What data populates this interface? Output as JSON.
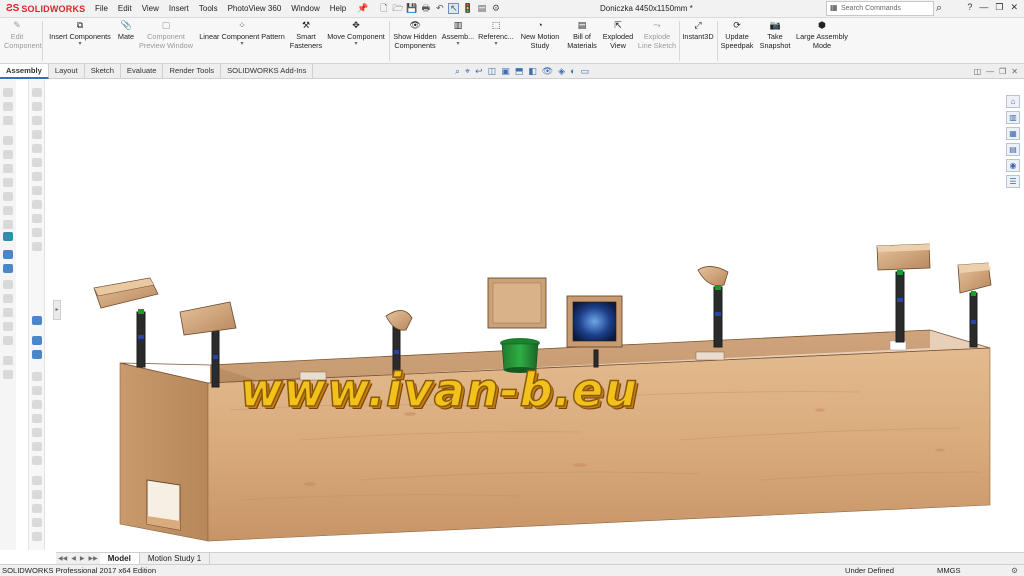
{
  "app": {
    "brand": "SOLIDWORKS",
    "document_title": "Doniczka 4450x1150mm *"
  },
  "menu": [
    "File",
    "Edit",
    "View",
    "Insert",
    "Tools",
    "PhotoView 360",
    "Window",
    "Help"
  ],
  "search": {
    "placeholder": "Search Commands"
  },
  "ribbon": {
    "edit_component": [
      "Edit",
      "Component"
    ],
    "insert_components": "Insert Components",
    "mate": "Mate",
    "component_preview": [
      "Component",
      "Preview Window"
    ],
    "linear_pattern": "Linear Component Pattern",
    "smart_fasteners": [
      "Smart",
      "Fasteners"
    ],
    "move_component": "Move Component",
    "show_hidden": [
      "Show Hidden",
      "Components"
    ],
    "assembly_features": "Assemb...",
    "reference_geometry": "Referenc...",
    "new_motion_study": [
      "New Motion",
      "Study"
    ],
    "bill_of_materials": [
      "Bill of",
      "Materials"
    ],
    "exploded_view": [
      "Exploded",
      "View"
    ],
    "explode_line_sketch": [
      "Explode",
      "Line Sketch"
    ],
    "instant3d": "Instant3D",
    "update_speedpak": [
      "Update",
      "Speedpak"
    ],
    "take_snapshot": [
      "Take",
      "Snapshot"
    ],
    "large_assembly_mode": [
      "Large Assembly",
      "Mode"
    ]
  },
  "tabs": [
    "Assembly",
    "Layout",
    "Sketch",
    "Evaluate",
    "Render Tools",
    "SOLIDWORKS Add-Ins"
  ],
  "watermark": "www.ivan-b.eu",
  "bottom_tabs": [
    "Model",
    "Motion Study 1"
  ],
  "status": {
    "edition": "SOLIDWORKS Professional 2017 x64 Edition",
    "state": "Under Defined",
    "units": "MMGS"
  },
  "colors": {
    "brand_red": "#d7262b",
    "wood_light": "#e2b88b",
    "wood_mid": "#d2a272",
    "wood_dark": "#b5845a",
    "watermark_fill": "#f2c21a",
    "accent_blue": "#3b6fb5"
  },
  "icons": [
    "solidworks-logo",
    "pin-icon",
    "new-icon",
    "open-icon",
    "save-icon",
    "print-icon",
    "undo-icon",
    "select-icon",
    "rebuild-icon",
    "options-icon",
    "search-icon",
    "help-icon",
    "minimize-icon",
    "restore-icon",
    "close-icon",
    "gear-icon"
  ]
}
